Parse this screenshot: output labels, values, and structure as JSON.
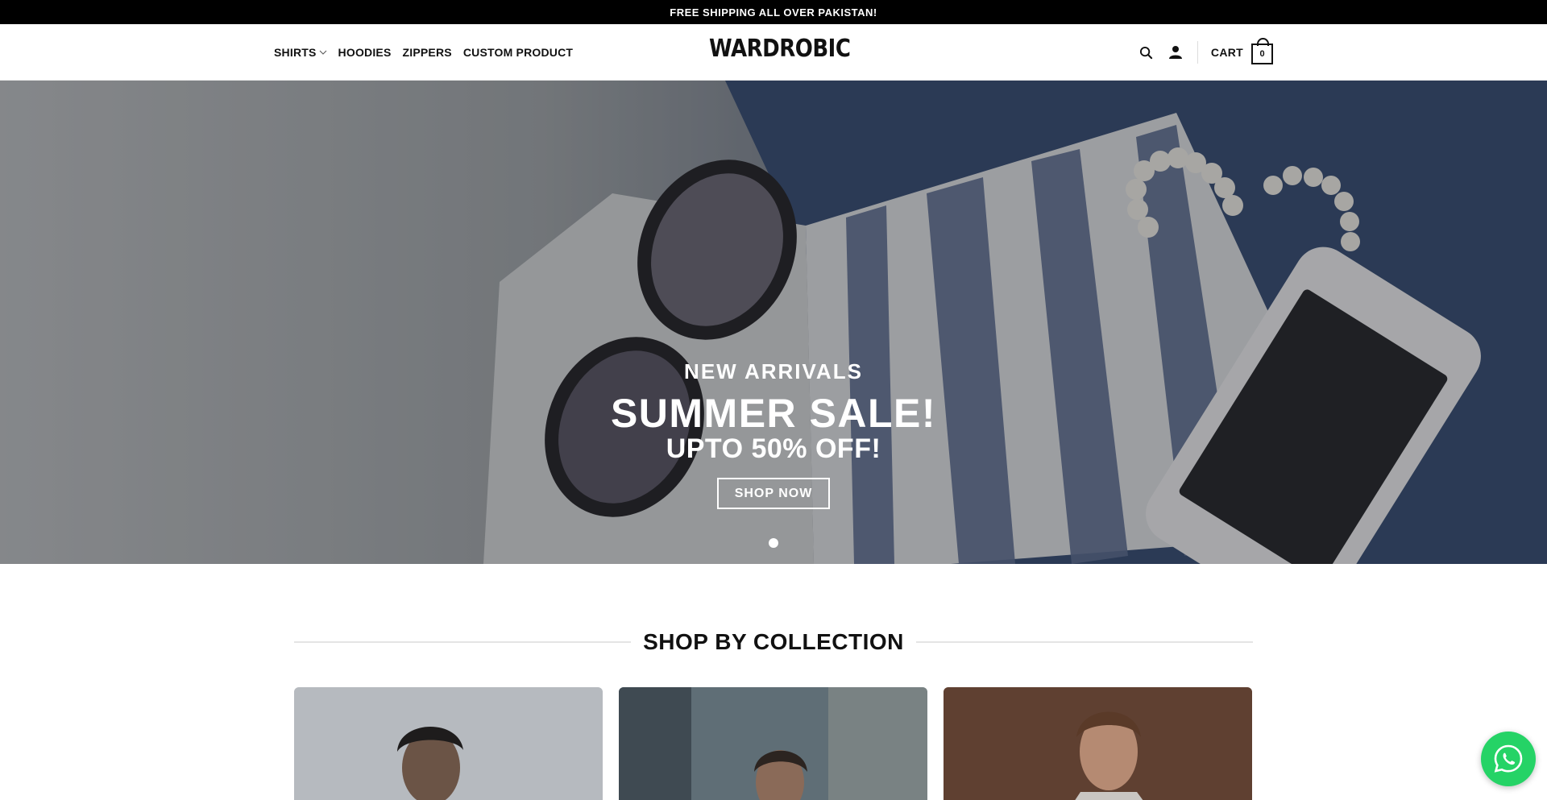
{
  "announcement": {
    "text": "FREE SHIPPING ALL OVER PAKISTAN!"
  },
  "header": {
    "logo": "WARDROBIC",
    "nav": [
      {
        "label": "SHIRTS",
        "has_dropdown": true
      },
      {
        "label": "HOODIES",
        "has_dropdown": false
      },
      {
        "label": "ZIPPERS",
        "has_dropdown": false
      },
      {
        "label": "CUSTOM PRODUCT",
        "has_dropdown": false
      }
    ],
    "icons": [
      "search-icon",
      "account-icon"
    ],
    "cart_label": "CART",
    "cart_count": "0"
  },
  "hero": {
    "subtitle": "NEW ARRIVALS",
    "title": "SUMMER SALE!",
    "offer": "UPTO 50% OFF!",
    "button": "SHOP NOW",
    "slides": 1,
    "active_slide": 1
  },
  "collection": {
    "title": "SHOP BY COLLECTION",
    "cards": [
      {
        "name": "collection-card-1",
        "bg": "#bfc3c8"
      },
      {
        "name": "collection-card-2",
        "bg": "#5b6b73"
      },
      {
        "name": "collection-card-3",
        "bg": "#6a4a38"
      }
    ]
  },
  "colors": {
    "topbar": "#000000",
    "accent": "#111111",
    "whatsapp": "#25d366"
  },
  "floating": {
    "icon": "whatsapp-icon"
  }
}
